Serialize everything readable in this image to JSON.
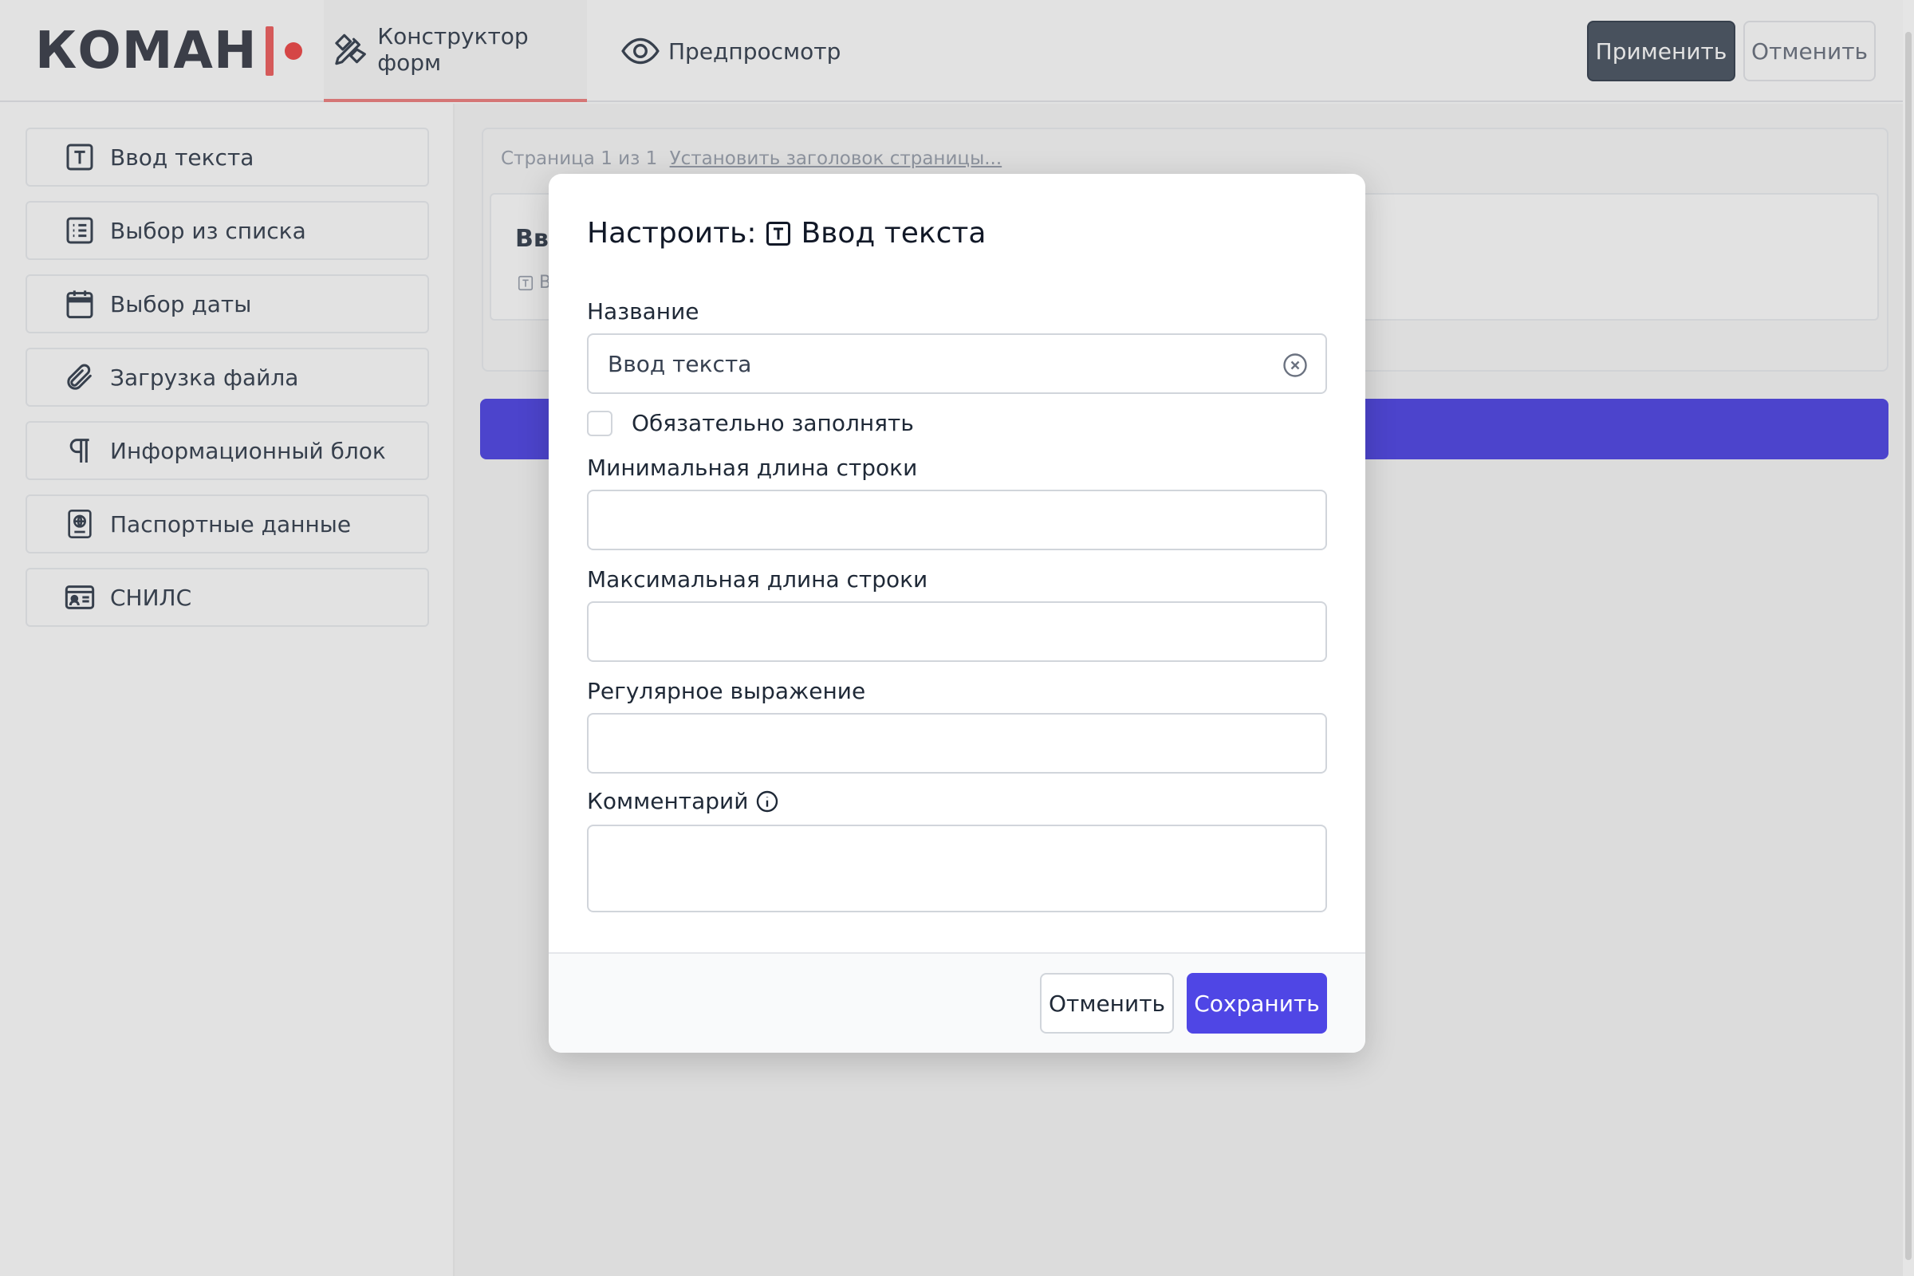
{
  "header": {
    "logo_text": "КОМАН",
    "tabs": [
      {
        "label": "Конструктор форм",
        "icon": "pencil-ruler-icon",
        "active": true
      },
      {
        "label": "Предпросмотр",
        "icon": "eye-icon",
        "active": false
      }
    ],
    "apply_label": "Применить",
    "cancel_label": "Отменить"
  },
  "sidebar": {
    "items": [
      {
        "label": "Ввод текста",
        "icon": "text-input-icon"
      },
      {
        "label": "Выбор из списка",
        "icon": "list-icon"
      },
      {
        "label": "Выбор даты",
        "icon": "calendar-icon"
      },
      {
        "label": "Загрузка файла",
        "icon": "paperclip-icon"
      },
      {
        "label": "Информационный блок",
        "icon": "paragraph-icon"
      },
      {
        "label": "Паспортные данные",
        "icon": "passport-icon"
      },
      {
        "label": "СНИЛС",
        "icon": "id-card-icon"
      }
    ]
  },
  "canvas": {
    "page_info": "Страница 1 из 1",
    "set_title_link": "Установить заголовок страницы...",
    "field_title": "Вв",
    "field_subtitle": "В"
  },
  "modal": {
    "title_prefix": "Настроить:",
    "title_field": "Ввод текста",
    "name_label": "Название",
    "name_value": "Ввод текста",
    "required_label": "Обязательно заполнять",
    "required_checked": false,
    "min_length_label": "Минимальная длина строки",
    "min_length_value": "",
    "max_length_label": "Максимальная длина строки",
    "max_length_value": "",
    "regex_label": "Регулярное выражение",
    "regex_value": "",
    "comment_label": "Комментарий",
    "comment_value": "",
    "cancel_label": "Отменить",
    "save_label": "Сохранить"
  },
  "colors": {
    "accent": "#4f46e5",
    "brand_red": "#f04848",
    "apply_button": "#4b5563"
  }
}
